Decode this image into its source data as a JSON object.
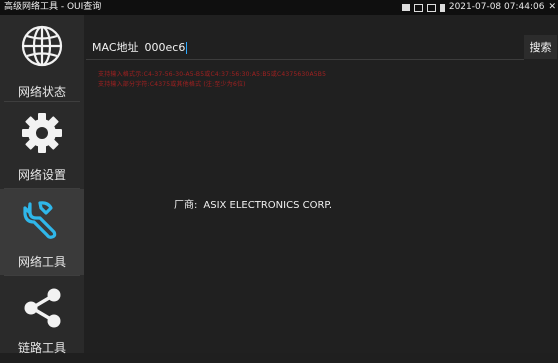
{
  "statusbar": {
    "app_title": "高级网络工具 - OUI查询",
    "datetime": "2021-07-08 07:44:06"
  },
  "sidebar": {
    "items": [
      {
        "label": "网络状态",
        "icon": "globe-icon",
        "active": false
      },
      {
        "label": "网络设置",
        "icon": "gear-icon",
        "active": false
      },
      {
        "label": "网络工具",
        "icon": "wrench-icon",
        "active": true
      },
      {
        "label": "链路工具",
        "icon": "share-icon",
        "active": false
      }
    ]
  },
  "main": {
    "search": {
      "label": "MAC地址",
      "value": "000ec6",
      "button_label": "搜索"
    },
    "hints": [
      "支持输入格式示:C4-37-56-30-A5-B5或C4:37:56:30:A5:B5或C4375630A5B5",
      "支持输入部分字符:C4375或其他格式 (注:至少为6位)"
    ],
    "result": {
      "vendor_label": "厂商:",
      "vendor_value": "ASIX ELECTRONICS CORP."
    }
  },
  "colors": {
    "hint_text": "#a02020",
    "caret": "#2aa8ff",
    "background": "#202020"
  }
}
